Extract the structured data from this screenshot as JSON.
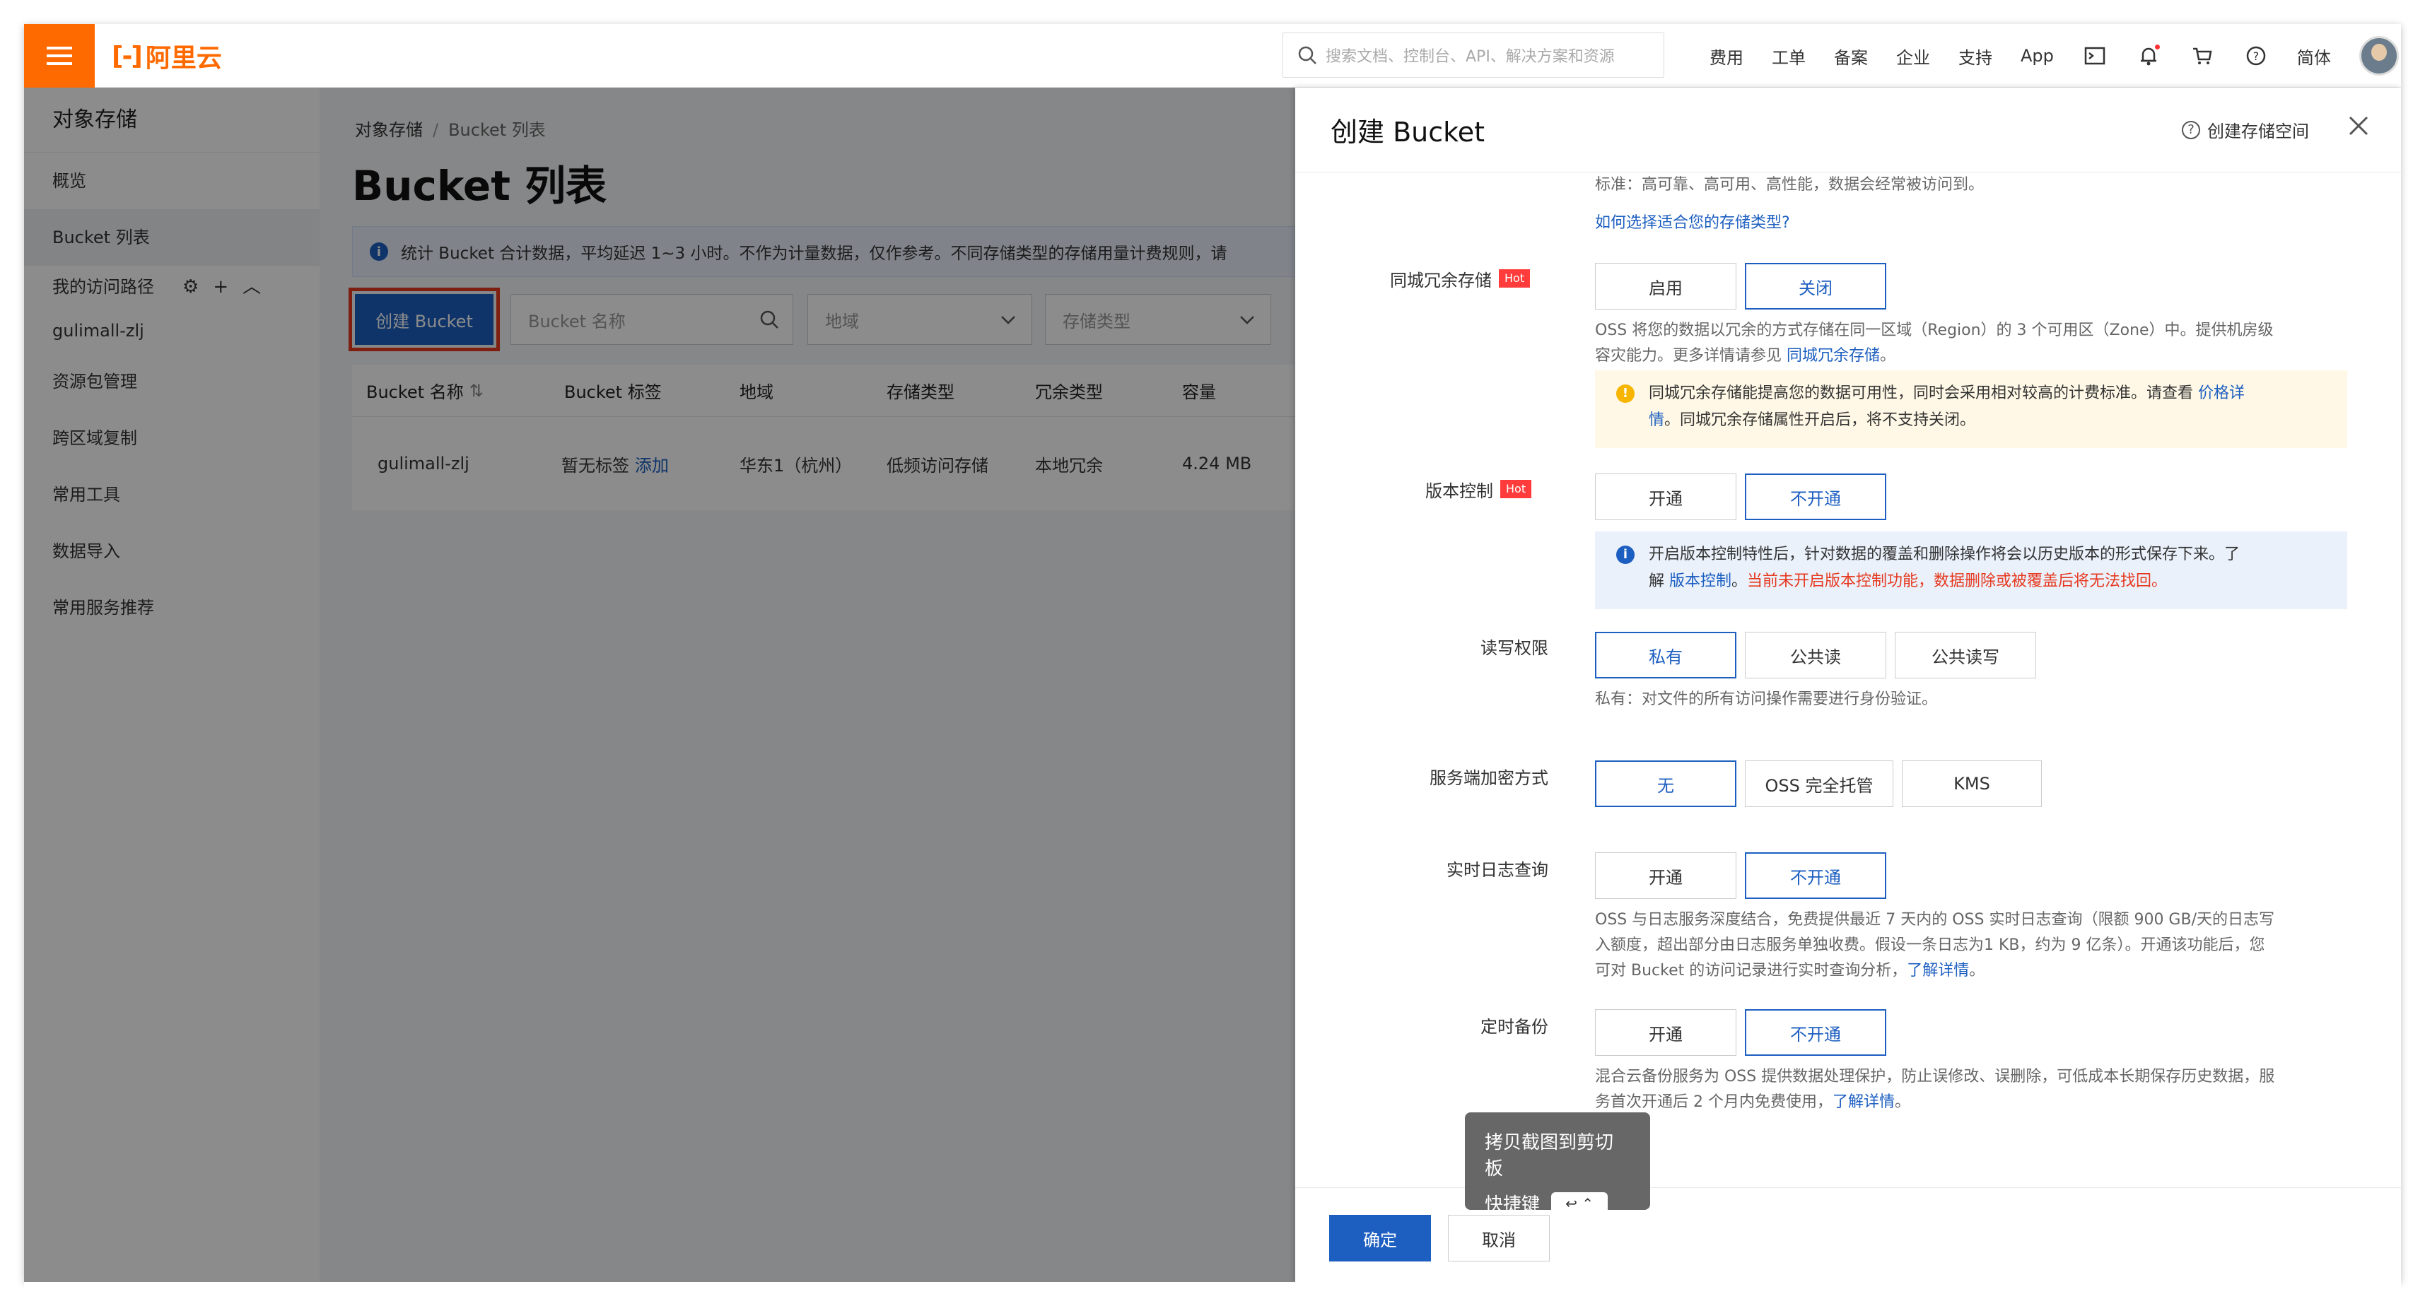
{
  "topbar": {
    "brand": "阿里云",
    "search_placeholder": "搜索文档、控制台、API、解决方案和资源",
    "nav": [
      "费用",
      "工单",
      "备案",
      "企业",
      "支持",
      "App"
    ],
    "lang": "简体"
  },
  "sidebar": {
    "title": "对象存储",
    "items": [
      "概览",
      "Bucket 列表"
    ],
    "path_label": "我的访问路径",
    "path_items": [
      "gulimall-zlj"
    ],
    "more_items": [
      "资源包管理",
      "跨区域复制",
      "常用工具",
      "数据导入",
      "常用服务推荐"
    ]
  },
  "main": {
    "breadcrumb": [
      "对象存储",
      "Bucket 列表"
    ],
    "title": "Bucket 列表",
    "notice": "统计 Bucket 合计数据，平均延迟 1~3 小时。不作为计量数据，仅作参考。不同存储类型的存储用量计费规则，请",
    "create_button": "创建 Bucket",
    "name_filter_placeholder": "Bucket 名称",
    "region_filter": "地域",
    "storage_filter": "存储类型",
    "columns": [
      "Bucket 名称",
      "Bucket 标签",
      "地域",
      "存储类型",
      "冗余类型",
      "容量"
    ],
    "rows": [
      {
        "name": "gulimall-zlj",
        "tag": "暂无标签",
        "tag_link": "添加",
        "region": "华东1（杭州）",
        "storage": "低频访问存储",
        "redundancy": "本地冗余",
        "size": "4.24 MB"
      }
    ]
  },
  "panel": {
    "title": "创建 Bucket",
    "help": "创建存储空间",
    "storage_desc": "标准：高可靠、高可用、高性能，数据会经常被访问到。",
    "storage_link": "如何选择适合您的存储类型?",
    "zrs": {
      "label": "同城冗余存储",
      "hot": "Hot",
      "options": [
        "启用",
        "关闭"
      ],
      "desc_a": "OSS 将您的数据以冗余的方式存储在同一区域（Region）的 3 个可用区（Zone）中。提供机房级",
      "desc_b": "容灾能力。更多详情请参见",
      "desc_link": "同城冗余存储",
      "desc_end": "。",
      "warn_a": "同城冗余存储能提高您的数据可用性，同时会采用相对较高的计费标准。请查看",
      "warn_link_a": "价格详",
      "warn_link_b": "情",
      "warn_b": "。同城冗余存储属性开启后，将不支持关闭。"
    },
    "versioning": {
      "label": "版本控制",
      "hot": "Hot",
      "options": [
        "开通",
        "不开通"
      ],
      "info_a": "开启版本控制特性后，针对数据的覆盖和删除操作将会以历史版本的形式保存下来。了",
      "info_b": "解",
      "info_link": "版本控制",
      "info_red": "当前未开启版本控制功能，数据删除或被覆盖后将无法找回。",
      "info_end": "。"
    },
    "acl": {
      "label": "读写权限",
      "options": [
        "私有",
        "公共读",
        "公共读写"
      ],
      "desc": "私有：对文件的所有访问操作需要进行身份验证。"
    },
    "encryption": {
      "label": "服务端加密方式",
      "options": [
        "无",
        "OSS 完全托管",
        "KMS"
      ]
    },
    "log": {
      "label": "实时日志查询",
      "options": [
        "开通",
        "不开通"
      ],
      "desc_a": "OSS 与日志服务深度结合，免费提供最近 7 天内的 OSS 实时日志查询（限额 900 GB/天的日志写",
      "desc_b": "入额度，超出部分由日志服务单独收费。假设一条日志为1 KB，约为 9 亿条）。开通该功能后，您",
      "desc_c": "可对 Bucket 的访问记录进行实时查询分析，",
      "desc_link": "了解详情",
      "desc_end": "。"
    },
    "backup": {
      "label": "定时备份",
      "options": [
        "开通",
        "不开通"
      ],
      "desc_a": "混合云备份服务为 OSS 提供数据处理保护，防止误修改、误删除，可低成本长期保存历史数据，服",
      "desc_b": "务首次开通后 2 个月内免费使用，",
      "desc_link": "了解详情",
      "desc_end": "。"
    },
    "ok": "确定",
    "cancel": "取消"
  },
  "tooltip": {
    "title": "拷贝截图到剪切板",
    "shortcut_label": "快捷键",
    "key": "↩ ⌃"
  },
  "colors": {
    "brand": "#ff6a00",
    "primary": "#1d5fc0",
    "hot": "#ff3b3b",
    "danger": "#e6391f"
  }
}
